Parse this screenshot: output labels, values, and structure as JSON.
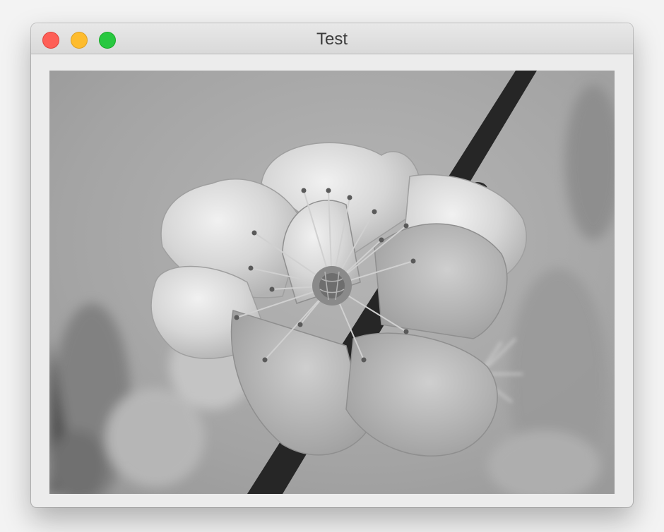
{
  "window": {
    "title": "Test"
  },
  "controls": {
    "close": "close-button",
    "minimize": "minimize-button",
    "zoom": "zoom-button"
  },
  "image": {
    "subject": "flower",
    "tone": "grayscale"
  },
  "colors": {
    "close": "#fe5f57",
    "minimize": "#febc2e",
    "zoom": "#28c840"
  }
}
